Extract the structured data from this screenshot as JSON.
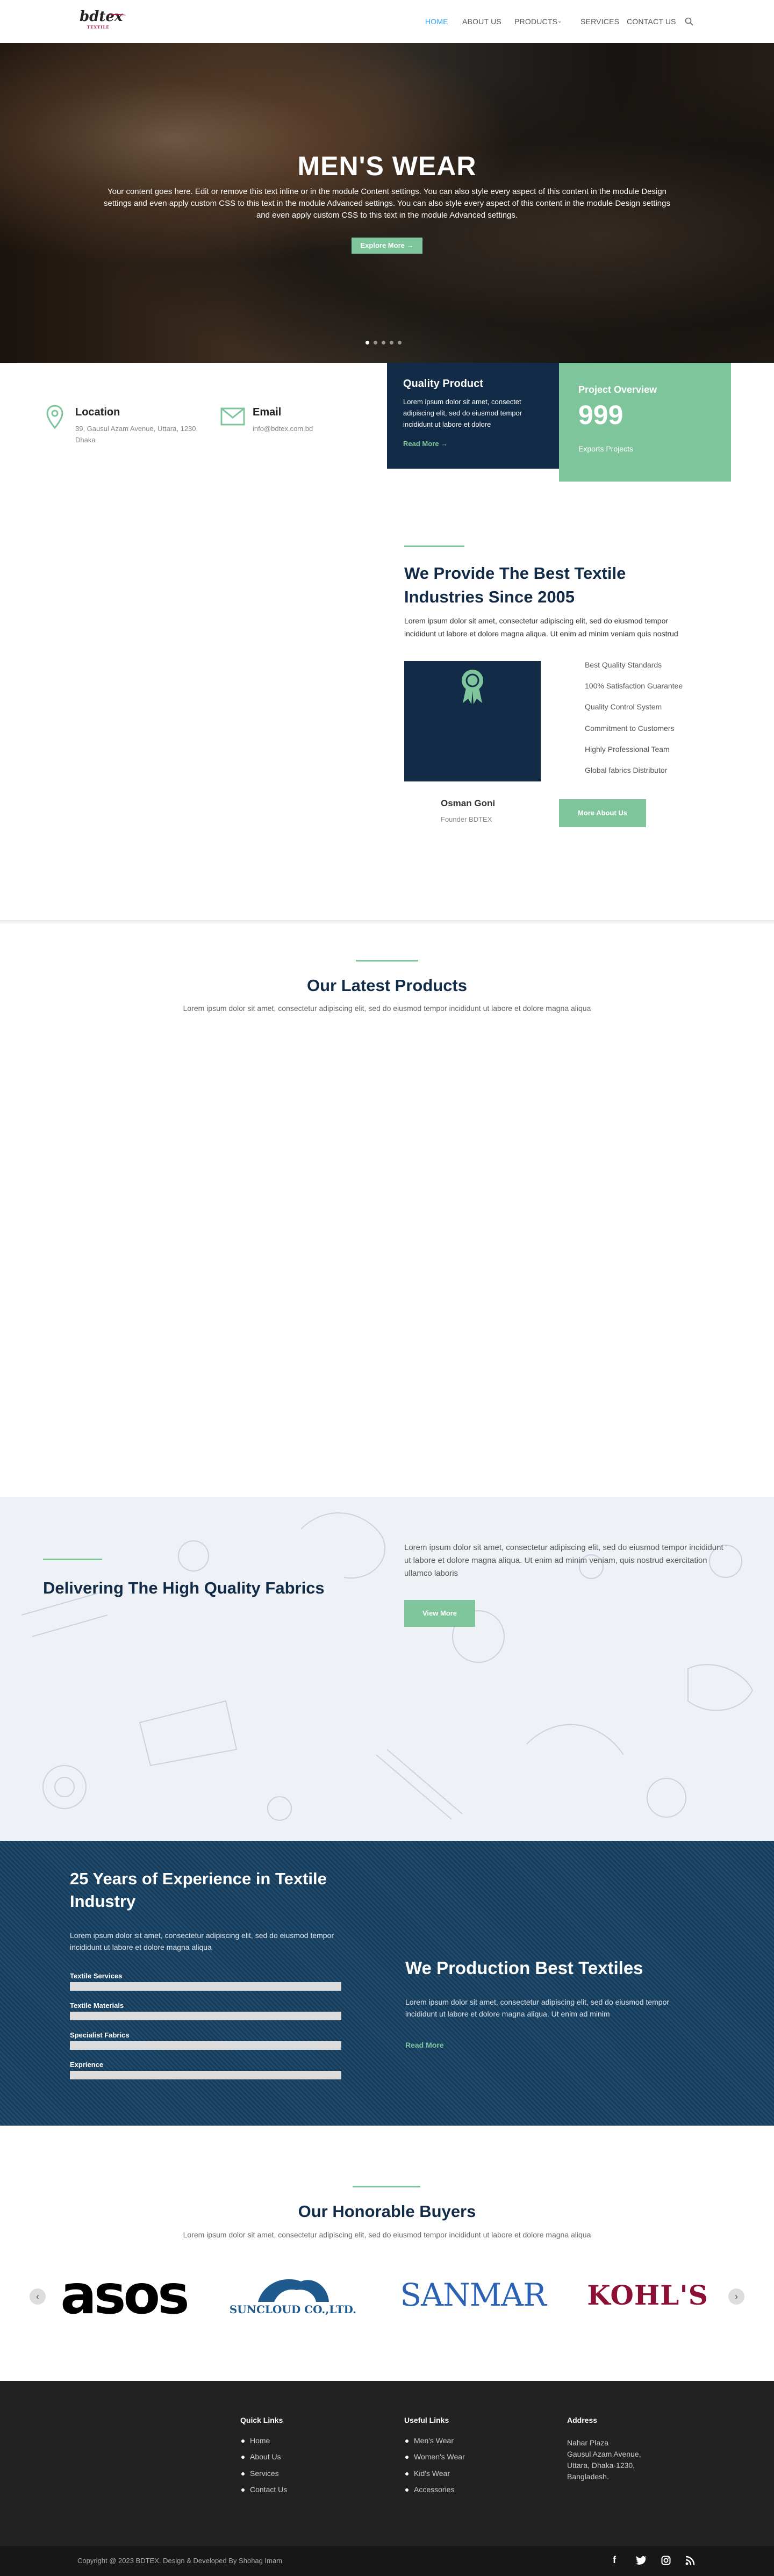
{
  "header": {
    "logo": "bdtex",
    "logo_sub": "TEXTILE",
    "nav": [
      "HOME",
      "ABOUT US",
      "PRODUCTS",
      "SERVICES",
      "CONTACT US"
    ]
  },
  "hero": {
    "title": "MEN'S WEAR",
    "text": "Your content goes here. Edit or remove this text inline or in the module Content settings. You can also style every aspect of this content in the module Design settings and even apply custom CSS to this text in the module Advanced settings. You can also style every aspect of this content in the module Design settings and even apply custom CSS to this text in the module Advanced settings.",
    "button": "Explore More",
    "slide_count": 5,
    "active_slide": 1
  },
  "info": {
    "location_title": "Location",
    "location_text": "39, Gausul Azam Avenue, Uttara, 1230, Dhaka",
    "email_title": "Email",
    "email_text": "info@bdtex.com.bd"
  },
  "quality": {
    "title": "Quality Product",
    "text": "Lorem ipsum dolor sit amet, consectet adipiscing elit, sed do eiusmod tempor incididunt ut labore et dolore",
    "link": "Read More"
  },
  "project": {
    "title": "Project Overview",
    "number": "999",
    "label": "Exports Projects"
  },
  "about": {
    "title": "We Provide The Best Textile Industries Since 2005",
    "text": "Lorem ipsum dolor sit amet, consectetur adipiscing elit, sed do eiusmod tempor incididunt ut labore et dolore magna aliqua. Ut enim ad minim veniam quis nostrud",
    "features": [
      "Best Quality Standards",
      "100% Satisfaction Guarantee",
      "Quality Control System",
      "Commitment to Customers",
      "Highly Professional Team",
      "Global fabrics Distributor"
    ],
    "person_name": "Osman Goni",
    "person_role": "Founder BDTEX",
    "button": "More About Us"
  },
  "products": {
    "title": "Our Latest Products",
    "subtitle": "Lorem ipsum dolor sit amet, consectetur adipiscing elit, sed do eiusmod tempor incididunt ut labore et dolore magna aliqua"
  },
  "fabric": {
    "title": "Delivering The High Quality Fabrics",
    "text": "Lorem ipsum dolor sit amet, consectetur adipiscing elit, sed do eiusmod tempor incididunt ut labore et dolore magna aliqua. Ut enim ad minim veniam, quis nostrud exercitation ullamco laboris",
    "button": "View More"
  },
  "experience": {
    "title": "25 Years of Experience in Textile Industry",
    "text": "Lorem ipsum dolor sit amet, consectetur adipiscing elit, sed do eiusmod tempor incididunt ut labore et dolore magna aliqua",
    "bars": [
      "Textile Services",
      "Textile Materials",
      "Specialist Fabrics",
      "Exprience"
    ],
    "right_title": "We Production Best Textiles",
    "right_text": "Lorem ipsum dolor sit amet, consectetur adipiscing elit, sed do eiusmod tempor incididunt ut labore et dolore magna aliqua. Ut enim ad minim",
    "right_link": "Read More"
  },
  "buyers": {
    "title": "Our Honorable Buyers",
    "subtitle": "Lorem ipsum dolor sit amet, consectetur adipiscing elit, sed do eiusmod tempor incididunt ut labore et dolore magna aliqua",
    "logos": [
      "asos",
      "SUNCLOUD CO.,LTD.",
      "SANMAR",
      "KOHL'S"
    ]
  },
  "footer": {
    "quick_title": "Quick Links",
    "quick": [
      "Home",
      "About Us",
      "Services",
      "Contact Us"
    ],
    "useful_title": "Useful Links",
    "useful": [
      "Men's Wear",
      "Women's Wear",
      "Kid's Wear",
      "Accessories"
    ],
    "address_title": "Address",
    "address_lines": [
      "Nahar Plaza",
      "Gausul Azam Avenue,",
      "Uttara, Dhaka-1230,",
      "Bangladesh."
    ],
    "copyright": "Copyright @ 2023 BDTEX. Design & Developed By Shohag Imam"
  },
  "colors": {
    "navy": "#122b46",
    "green": "#7ec59c",
    "link_blue": "#2ea3f2"
  }
}
